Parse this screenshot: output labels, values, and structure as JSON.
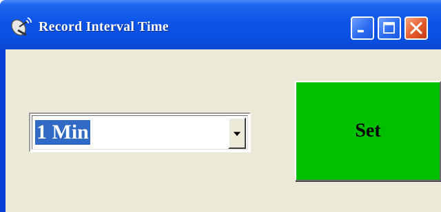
{
  "window": {
    "title": "Record Interval Time",
    "title_icon": "satellite-dish-icon",
    "controls": {
      "minimize_icon": "minimize-icon",
      "maximize_icon": "maximize-icon",
      "close_icon": "close-icon"
    }
  },
  "interval": {
    "selected_value": "1 Min",
    "dropdown_icon": "chevron-down-icon"
  },
  "actions": {
    "set_label": "Set"
  },
  "colors": {
    "titlebar": "#0a4fe0",
    "client_bg": "#ece9d8",
    "selection": "#316ac5",
    "set_button": "#00c000",
    "close_button": "#e55b2c"
  }
}
